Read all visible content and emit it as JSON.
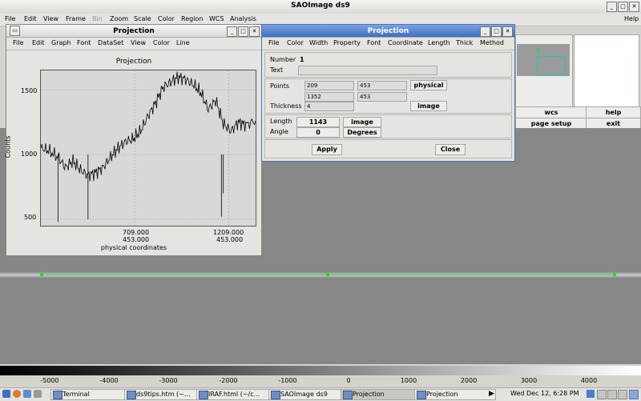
{
  "ds9": {
    "title": "SAOImage ds9",
    "menu": [
      "File",
      "Edit",
      "View",
      "Frame",
      "Bin",
      "Zoom",
      "Scale",
      "Color",
      "Region",
      "WCS",
      "Analysis"
    ],
    "help": "Help",
    "buttons": {
      "wcs": "wcs",
      "help": "help",
      "page_setup": "page setup",
      "exit": "exit"
    },
    "colorbar_ticks": [
      "-5000",
      "-4000",
      "-3000",
      "-2000",
      "-1000",
      "0",
      "1000",
      "2000",
      "3000",
      "4000"
    ]
  },
  "graph": {
    "window_title": "Projection",
    "menu": [
      "File",
      "Edit",
      "Graph",
      "Font",
      "DataSet",
      "View",
      "Color",
      "Line"
    ],
    "plot_title": "Projection",
    "ylabel": "Counts",
    "xlabel": "physical coordinates",
    "x_ticks": [
      {
        "line1": "709.000",
        "line2": "453.000"
      },
      {
        "line1": "1209.000",
        "line2": "453.000"
      }
    ],
    "y_ticks": [
      "1500",
      "1000",
      "500"
    ]
  },
  "chart_data": {
    "type": "line",
    "title": "Projection",
    "xlabel": "physical coordinates",
    "ylabel": "Counts",
    "x_tick_labels": [
      "709.000 453.000",
      "1209.000 453.000"
    ],
    "xlim": [
      209,
      1352
    ],
    "ylim": [
      450,
      1650
    ],
    "grid": true,
    "series": [
      {
        "x": [
          209,
          250,
          300,
          340,
          380,
          420,
          460,
          500,
          540,
          580,
          620,
          660,
          700,
          740,
          780,
          820,
          860,
          900,
          940,
          980,
          1020,
          1060,
          1100,
          1140,
          1180,
          1220,
          1260,
          1300,
          1352
        ],
        "values": [
          1050,
          1030,
          980,
          900,
          950,
          880,
          840,
          860,
          900,
          980,
          1050,
          1100,
          1120,
          1180,
          1300,
          1400,
          1520,
          1560,
          1600,
          1580,
          1540,
          1480,
          1350,
          1420,
          1240,
          1180,
          1250,
          1230,
          1260
        ]
      }
    ]
  },
  "projection": {
    "window_title": "Projection",
    "menu": [
      "File",
      "Color",
      "Width",
      "Property",
      "Font",
      "Coordinate",
      "Length",
      "Thick",
      "Method"
    ],
    "number_label": "Number",
    "number_value": "1",
    "text_label": "Text",
    "text_value": "",
    "points_label": "Points",
    "p1x": "209",
    "p1y": "453",
    "p2x": "1352",
    "p2y": "453",
    "points_coord": "physical",
    "thickness_label": "Thickness",
    "thickness_value": "4",
    "thickness_coord": "image",
    "length_label": "Length",
    "length_value": "1143",
    "length_coord": "image",
    "angle_label": "Angle",
    "angle_value": "0",
    "angle_unit": "Degrees",
    "apply": "Apply",
    "close": "Close"
  },
  "taskbar": {
    "tasks": [
      "Terminal",
      "ds9tips.htm (~...",
      "IRAF.html (~/c...",
      "SAOImage ds9",
      "Projection",
      "Projection"
    ],
    "clock": "Wed Dec 12,  6:28 PM"
  },
  "colors": {
    "line": "#2bd62b",
    "title_active": "#3d6fc6"
  }
}
